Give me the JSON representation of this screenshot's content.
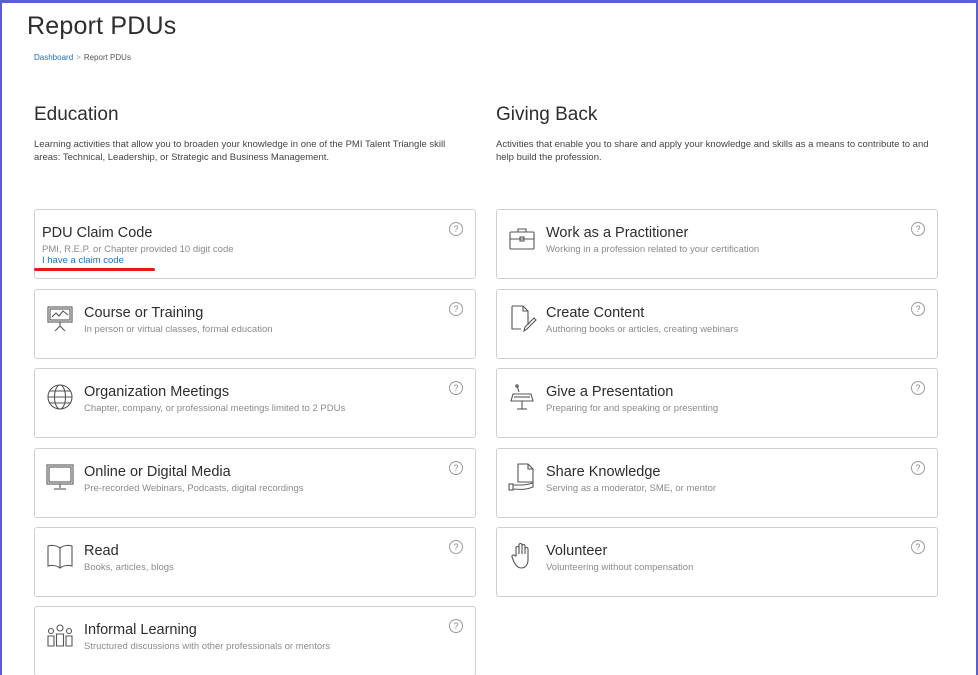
{
  "page": {
    "title": "Report PDUs"
  },
  "breadcrumb": {
    "home": "Dashboard",
    "separator": ">",
    "current": "Report PDUs"
  },
  "education": {
    "heading": "Education",
    "description": "Learning activities that allow you to broaden your knowledge in one of the PMI Talent Triangle skill areas: Technical, Leadership, or Strategic and Business Management.",
    "claim_card": {
      "title": "PDU Claim Code",
      "subtitle": "PMI, R.E.P. or Chapter provided 10 digit code",
      "link": "I have a claim code"
    },
    "cards": [
      {
        "title": "Course or Training",
        "subtitle": "In person or virtual classes, formal education",
        "icon": "presentation-board-icon"
      },
      {
        "title": "Organization Meetings",
        "subtitle": "Chapter, company, or professional meetings limited to 2 PDUs",
        "icon": "globe-icon"
      },
      {
        "title": "Online or Digital Media",
        "subtitle": "Pre-recorded Webinars, Podcasts, digital recordings",
        "icon": "monitor-icon"
      },
      {
        "title": "Read",
        "subtitle": "Books, articles, blogs",
        "icon": "open-book-icon"
      },
      {
        "title": "Informal Learning",
        "subtitle": "Structured discussions with other professionals or mentors",
        "icon": "people-group-icon"
      }
    ]
  },
  "giving_back": {
    "heading": "Giving Back",
    "description": "Activities that enable you to share and apply your knowledge and skills as a means to contribute to and help build the profession.",
    "cards": [
      {
        "title": "Work as a Practitioner",
        "subtitle": "Working in a profession related to your certification",
        "icon": "briefcase-icon"
      },
      {
        "title": "Create Content",
        "subtitle": "Authoring books or articles, creating webinars",
        "icon": "document-pencil-icon"
      },
      {
        "title": "Give a Presentation",
        "subtitle": "Preparing for and speaking or presenting",
        "icon": "podium-icon"
      },
      {
        "title": "Share Knowledge",
        "subtitle": "Serving as a moderator, SME, or mentor",
        "icon": "document-hand-icon"
      },
      {
        "title": "Volunteer",
        "subtitle": "Volunteering without compensation",
        "icon": "raised-hand-icon"
      }
    ]
  },
  "help_glyph": "?",
  "colors": {
    "link": "#1f6fb8",
    "annotation_underline": "#e01b1b",
    "frame": "#5a5ed0",
    "card_border": "#cfcfcf"
  }
}
